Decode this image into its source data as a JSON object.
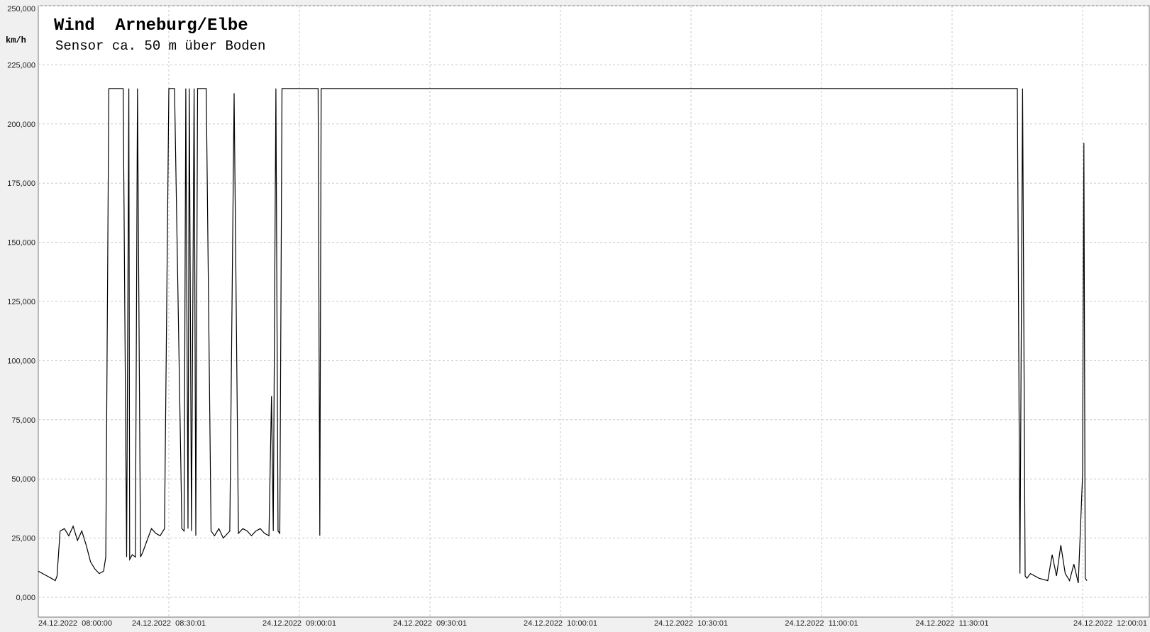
{
  "chart_data": {
    "type": "line",
    "title": "Wind  Arneburg/Elbe",
    "subtitle": "Sensor ca. 50 m über Boden",
    "ylabel": "km/h",
    "xlabel": "",
    "ylim": [
      0,
      250000
    ],
    "xlim_minutes": [
      0,
      241
    ],
    "grid": true,
    "y_ticks": [
      {
        "value": 0,
        "label": "0,000"
      },
      {
        "value": 25000,
        "label": "25,000"
      },
      {
        "value": 50000,
        "label": "50,000"
      },
      {
        "value": 75000,
        "label": "75,000"
      },
      {
        "value": 100000,
        "label": "100,000"
      },
      {
        "value": 125000,
        "label": "125,000"
      },
      {
        "value": 150000,
        "label": "150,000"
      },
      {
        "value": 175000,
        "label": "175,000"
      },
      {
        "value": 200000,
        "label": "200,000"
      },
      {
        "value": 225000,
        "label": "225,000"
      },
      {
        "value": 250000,
        "label": "250,000"
      }
    ],
    "x_ticks": [
      {
        "minute": 0,
        "label": "24.12.2022  08:00:00"
      },
      {
        "minute": 30,
        "label": "24.12.2022  08:30:01"
      },
      {
        "minute": 60,
        "label": "24.12.2022  09:00:01"
      },
      {
        "minute": 90,
        "label": "24.12.2022  09:30:01"
      },
      {
        "minute": 120,
        "label": "24.12.2022  10:00:01"
      },
      {
        "minute": 150,
        "label": "24.12.2022  10:30:01"
      },
      {
        "minute": 180,
        "label": "24.12.2022  11:00:01"
      },
      {
        "minute": 210,
        "label": "24.12.2022  11:30:01"
      },
      {
        "minute": 240,
        "label": "24.12.2022  12:00:01"
      }
    ],
    "series": [
      {
        "color": "#000000",
        "x": [
          0,
          1,
          2,
          3,
          3.9,
          4.3,
          5,
          6,
          7,
          8,
          9,
          10,
          11,
          12,
          13,
          14,
          15,
          15.5,
          16.2,
          16.6,
          17.5,
          18.5,
          19.5,
          20.3,
          20.8,
          21,
          21.6,
          22.3,
          22.8,
          23.5,
          24,
          25,
          26,
          27,
          28,
          29,
          30,
          30.6,
          31.3,
          33,
          33.5,
          33.9,
          34.4,
          34.7,
          35.2,
          35.8,
          36.2,
          36.6,
          37,
          37.7,
          38.6,
          39.7,
          40.5,
          41.5,
          42.5,
          44,
          45,
          46,
          47,
          48,
          49,
          50,
          51,
          52,
          53,
          53.6,
          54,
          54.6,
          55.1,
          55.5,
          56,
          56.5,
          57,
          57.5,
          63,
          64.3,
          64.7,
          65,
          65.3,
          66,
          90,
          120,
          150,
          180,
          210,
          225,
          225.6,
          226.2,
          226.8,
          227.2,
          228,
          230,
          232,
          233,
          234,
          235,
          236,
          237,
          238,
          239,
          240,
          240.3,
          240.6,
          241
        ],
        "values": [
          11000,
          10000,
          9000,
          8000,
          7000,
          9000,
          28000,
          29000,
          26000,
          30000,
          24000,
          28000,
          22000,
          15000,
          12000,
          10000,
          11000,
          17000,
          215000,
          215000,
          215000,
          215000,
          215000,
          17000,
          215000,
          16000,
          18000,
          17000,
          215000,
          17000,
          19000,
          24000,
          29000,
          27000,
          26000,
          29000,
          215000,
          215000,
          215000,
          29000,
          28000,
          215000,
          29000,
          215000,
          28000,
          215000,
          26000,
          215000,
          215000,
          215000,
          215000,
          28000,
          26000,
          29000,
          25000,
          28000,
          213000,
          27000,
          29000,
          28000,
          26000,
          28000,
          29000,
          27000,
          26000,
          85000,
          28000,
          215000,
          28000,
          27000,
          215000,
          215000,
          215000,
          215000,
          215000,
          215000,
          26000,
          215000,
          215000,
          215000,
          215000,
          215000,
          215000,
          215000,
          215000,
          215000,
          10000,
          215000,
          9000,
          8000,
          10000,
          8000,
          7000,
          18000,
          9000,
          22000,
          10000,
          7000,
          14000,
          6000,
          52000,
          192000,
          8000,
          7000
        ]
      }
    ]
  }
}
